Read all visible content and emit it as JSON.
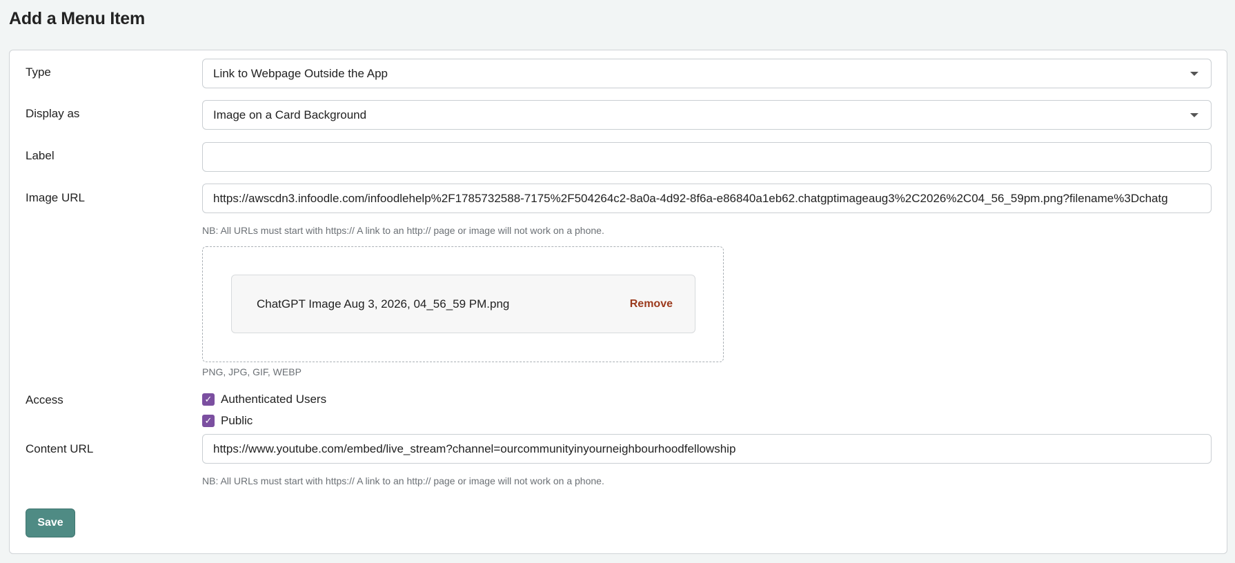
{
  "page": {
    "title": "Add a Menu Item"
  },
  "form": {
    "type": {
      "label": "Type",
      "value": "Link to Webpage Outside the App",
      "icon": "chevron-down-icon"
    },
    "display_as": {
      "label": "Display as",
      "value": "Image on a Card Background",
      "icon": "chevron-down-icon"
    },
    "label_field": {
      "label": "Label",
      "value": ""
    },
    "image_url": {
      "label": "Image URL",
      "value": "https://awscdn3.infoodle.com/infoodlehelp%2F1785732588-7175%2F504264c2-8a0a-4d92-8f6a-e86840a1eb62.chatgptimageaug3%2C2026%2C04_56_59pm.png?filename%3Dchatg",
      "hint": "NB: All URLs must start with https:// A link to an http:// page or image will not work on a phone."
    },
    "upload": {
      "file_name": "ChatGPT Image Aug 3, 2026, 04_56_59 PM.png",
      "remove_label": "Remove",
      "formats": "PNG, JPG, GIF, WEBP"
    },
    "access": {
      "label": "Access",
      "options": [
        {
          "label": "Authenticated Users",
          "checked": true
        },
        {
          "label": "Public",
          "checked": true
        }
      ],
      "check_icon": "checkmark-icon"
    },
    "content_url": {
      "label": "Content URL",
      "value": "https://www.youtube.com/embed/live_stream?channel=ourcommunityinyourneighbourhoodfellowship",
      "hint": "NB: All URLs must start with https:// A link to an http:// page or image will not work on a phone."
    },
    "save_label": "Save"
  },
  "colors": {
    "accent": "#4f8b84",
    "checkbox": "#7b4fa0",
    "remove": "#9b3a1d",
    "background": "#f2f5f5"
  }
}
